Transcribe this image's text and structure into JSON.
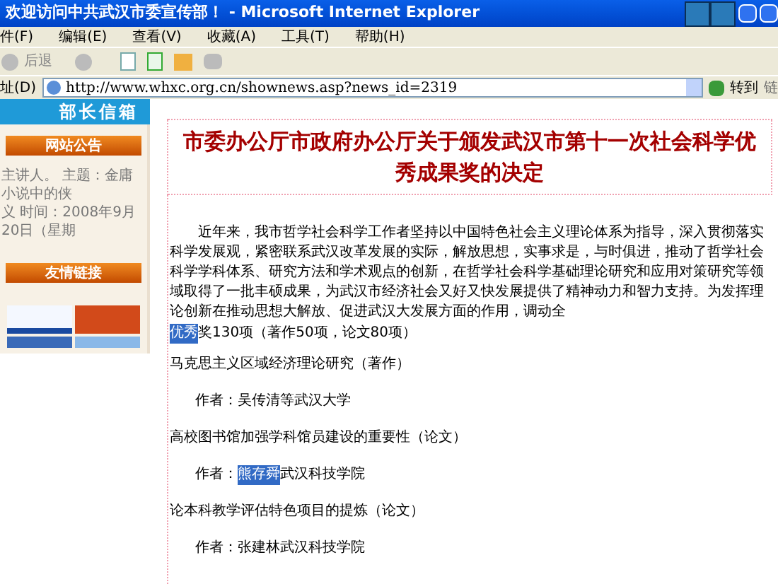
{
  "window": {
    "title": "欢迎访问中共武汉市委宣传部！ - Microsoft Internet Explorer"
  },
  "menu": [
    "件(F)",
    "编辑(E)",
    "查看(V)",
    "收藏(A)",
    "工具(T)",
    "帮助(H)"
  ],
  "toolbar": {
    "back": "后退"
  },
  "address": {
    "label": "址(D)",
    "value": "http://www.whxc.org.cn/shownews.asp?news_id=2319",
    "go": "转到",
    "links": "链"
  },
  "sidebar": {
    "mailbox": "部长信箱",
    "notice_title": "网站公告",
    "notice_lines": [
      "主讲人。 主题：金庸小说中的侠",
      "义 时间：2008年9月20日（星期"
    ],
    "links_title": "友情链接"
  },
  "article": {
    "title": "市委办公厅市政府办公厅关于颁发武汉市第十一次社会科学优秀成果奖的决定",
    "paragraph": "近年来，我市哲学社会科学工作者坚持以中国特色社会主义理论体系为指导，深入贯彻落实科学发展观，紧密联系武汉改革发展的实际，解放思想，实事求是，与时俱进，推动了哲学社会科学学科体系、研究方法和学术观点的创新，在哲学社会科学基础理论研究和应用对策研究等领域取得了一批丰硕成果，为武汉市经济社会又好又快发展提供了精神动力和智力支持。为发挥理论创新在推动思想大解放、促进武汉大发展方面的作用，调动全",
    "entries": [
      {
        "kind": "summary",
        "highlight": "优秀",
        "text": "奖130项（著作50项，论文80项）"
      },
      {
        "kind": "work",
        "text": "马克思主义区域经济理论研究（著作）"
      },
      {
        "kind": "author",
        "label": "作者：",
        "text": "吴传清等武汉大学"
      },
      {
        "kind": "work",
        "text": "高校图书馆加强学科馆员建设的重要性（论文）"
      },
      {
        "kind": "author",
        "label": "作者：",
        "highlight": "熊存舜",
        "text": "武汉科技学院"
      },
      {
        "kind": "work",
        "text": "论本科教学评估特色项目的提炼（论文）"
      },
      {
        "kind": "author",
        "label": "作者：",
        "text": "张建林武汉科技学院"
      }
    ]
  }
}
